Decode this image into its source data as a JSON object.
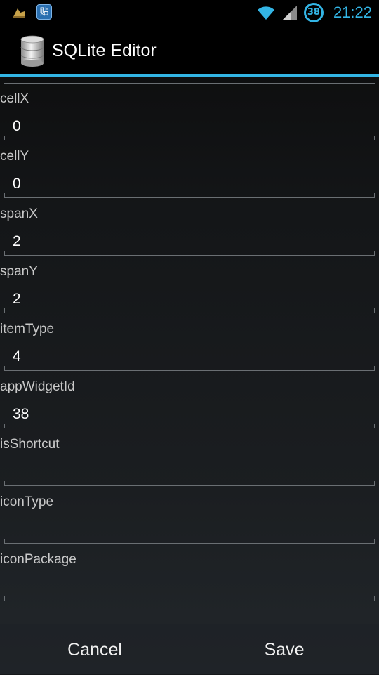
{
  "status_bar": {
    "clock": "21:22",
    "battery_level": "38",
    "tie_label": "贴"
  },
  "app": {
    "title": "SQLite Editor"
  },
  "fields": [
    {
      "label": "cellX",
      "value": "0"
    },
    {
      "label": "cellY",
      "value": "0"
    },
    {
      "label": "spanX",
      "value": "2"
    },
    {
      "label": "spanY",
      "value": "2"
    },
    {
      "label": "itemType",
      "value": "4"
    },
    {
      "label": "appWidgetId",
      "value": "38"
    },
    {
      "label": "isShortcut",
      "value": ""
    },
    {
      "label": "iconType",
      "value": ""
    },
    {
      "label": "iconPackage",
      "value": ""
    }
  ],
  "buttons": {
    "cancel": "Cancel",
    "save": "Save"
  },
  "colors": {
    "accent": "#33b5e5",
    "background": "#151719"
  }
}
